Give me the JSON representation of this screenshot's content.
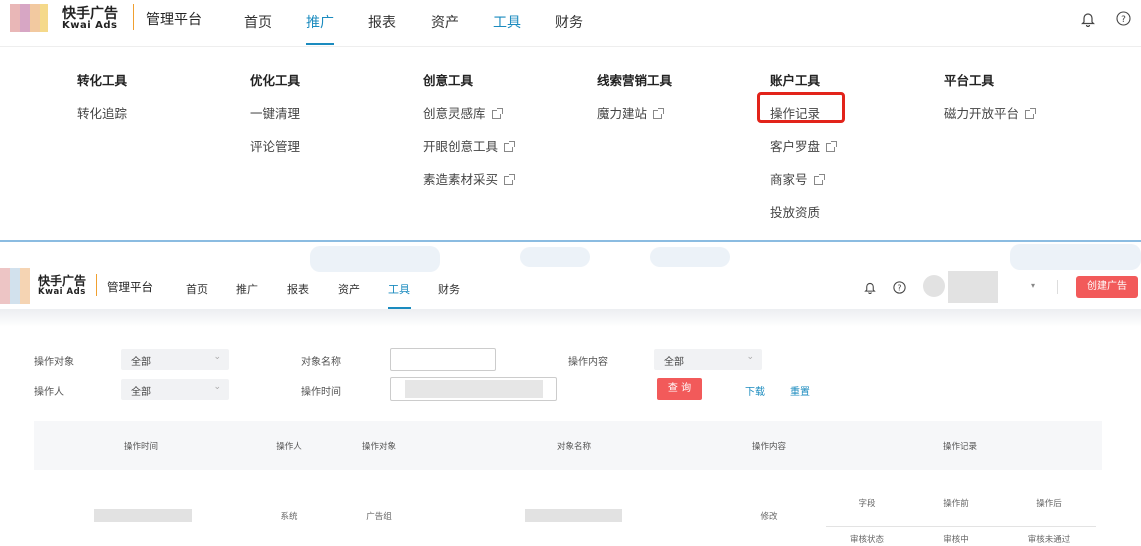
{
  "top": {
    "logo_cn": "快手广告",
    "logo_en": "Kwai Ads",
    "platform": "管理平台",
    "nav": [
      "首页",
      "推广",
      "报表",
      "资产",
      "工具",
      "财务"
    ]
  },
  "mega_menu": {
    "categories": [
      {
        "title": "转化工具",
        "links": [
          {
            "label": "转化追踪",
            "external": false
          }
        ]
      },
      {
        "title": "优化工具",
        "links": [
          {
            "label": "一键清理",
            "external": false
          },
          {
            "label": "评论管理",
            "external": false
          }
        ]
      },
      {
        "title": "创意工具",
        "links": [
          {
            "label": "创意灵感库",
            "external": true
          },
          {
            "label": "开眼创意工具",
            "external": true
          },
          {
            "label": "素造素材采买",
            "external": true
          }
        ]
      },
      {
        "title": "线索营销工具",
        "links": [
          {
            "label": "魔力建站",
            "external": true
          }
        ]
      },
      {
        "title": "账户工具",
        "links": [
          {
            "label": "操作记录",
            "external": false,
            "highlighted": true
          },
          {
            "label": "客户罗盘",
            "external": true
          },
          {
            "label": "商家号",
            "external": true
          },
          {
            "label": "投放资质",
            "external": false
          }
        ]
      },
      {
        "title": "平台工具",
        "links": [
          {
            "label": "磁力开放平台",
            "external": true
          }
        ]
      }
    ],
    "highlight_color": "#e2231a"
  },
  "second": {
    "logo_cn": "快手广告",
    "logo_en": "Kwai Ads",
    "platform": "管理平台",
    "nav": [
      "首页",
      "推广",
      "报表",
      "资产",
      "工具",
      "财务"
    ],
    "active_nav": "工具",
    "create_button": "创建广告",
    "accent": "#1b8bbf",
    "button_color": "#f25a5a"
  },
  "filters": {
    "object_label": "操作对象",
    "object_value": "全部",
    "name_label": "对象名称",
    "name_value": "",
    "content_label": "操作内容",
    "content_value": "全部",
    "operator_label": "操作人",
    "operator_value": "全部",
    "time_label": "操作时间",
    "query_button": "查 询",
    "download_link": "下载",
    "reset_link": "重置"
  },
  "table": {
    "headers": [
      "操作时间",
      "操作人",
      "操作对象",
      "对象名称",
      "操作内容",
      "操作记录"
    ],
    "row": {
      "operator": "系统",
      "object": "广告组",
      "content": "修改",
      "sub_headers": [
        "字段",
        "操作前",
        "操作后"
      ],
      "sub_values": [
        "审核状态",
        "审核中",
        "审核未通过"
      ]
    }
  }
}
